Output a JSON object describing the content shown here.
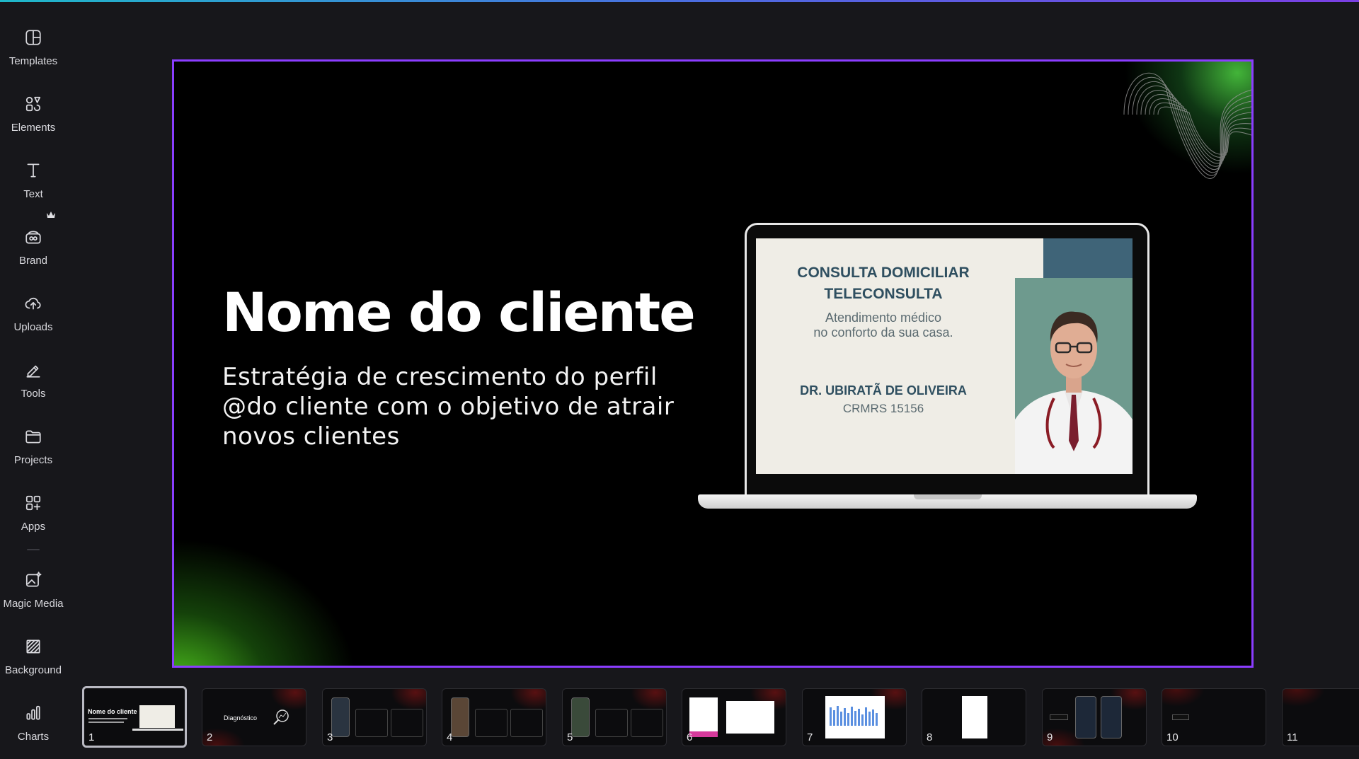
{
  "sidebar": {
    "items": [
      {
        "label": "Templates",
        "icon": "templates-icon"
      },
      {
        "label": "Elements",
        "icon": "elements-icon"
      },
      {
        "label": "Text",
        "icon": "text-icon"
      },
      {
        "label": "Brand",
        "icon": "brand-icon"
      },
      {
        "label": "Uploads",
        "icon": "uploads-icon"
      },
      {
        "label": "Tools",
        "icon": "tools-icon"
      },
      {
        "label": "Projects",
        "icon": "projects-icon"
      },
      {
        "label": "Apps",
        "icon": "apps-icon"
      },
      {
        "label": "Magic Media",
        "icon": "magic-media-icon"
      },
      {
        "label": "Background",
        "icon": "background-icon"
      },
      {
        "label": "Charts",
        "icon": "charts-icon"
      }
    ]
  },
  "slide": {
    "title": "Nome do cliente",
    "subtitle": "Estratégia de crescimento do perfil @do cliente com o objetivo de atrair novos clientes",
    "laptop_screen": {
      "heading_line1": "CONSULTA DOMICILIAR",
      "heading_line2": "TELECONSULTA",
      "tagline_line1": "Atendimento médico",
      "tagline_line2": "no conforto da sua casa.",
      "doctor_name": "DR. UBIRATÃ DE OLIVEIRA",
      "doctor_id": "CRMRS 15156"
    }
  },
  "filmstrip": {
    "thumbnails": [
      {
        "number": "1",
        "text": "Nome do cliente",
        "active": true
      },
      {
        "number": "2",
        "text": "Diagnóstico",
        "active": false
      },
      {
        "number": "3",
        "active": false
      },
      {
        "number": "4",
        "active": false
      },
      {
        "number": "5",
        "active": false
      },
      {
        "number": "6",
        "active": false
      },
      {
        "number": "7",
        "active": false
      },
      {
        "number": "8",
        "active": false
      },
      {
        "number": "9",
        "active": false
      },
      {
        "number": "10",
        "active": false
      },
      {
        "number": "11",
        "active": false
      }
    ]
  },
  "colors": {
    "accent": "#8b3dff",
    "background": "#17171b",
    "slide_background": "#000000",
    "glow_green": "#4fc81e"
  }
}
